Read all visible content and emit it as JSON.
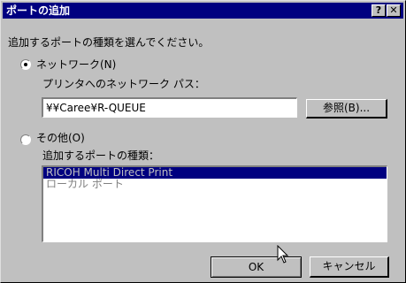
{
  "window": {
    "title": "ポートの追加",
    "help_label": "?",
    "close_label": "✕"
  },
  "instruction": "追加するポートの種類を選んでください。",
  "network": {
    "radio_label": "ネットワーク(N)",
    "selected": true,
    "path_label": "プリンタへのネットワーク パス：",
    "path_value": "¥¥Caree¥R-QUEUE",
    "browse_label": "参照(B)..."
  },
  "other": {
    "radio_label": "その他(O)",
    "selected": false,
    "type_label": "追加するポートの種類：",
    "port_types": [
      {
        "label": "RICOH Multi Direct Print",
        "selected": true
      },
      {
        "label": "ローカル ポート",
        "selected": false
      }
    ]
  },
  "buttons": {
    "ok_label": "OK",
    "cancel_label": "キャンセル"
  },
  "colors": {
    "titlebar": "#000080",
    "face": "#c0c0c0",
    "selection": "#000080",
    "disabled_text": "#808080"
  },
  "icons": {
    "cursor": "mouse-pointer-icon"
  }
}
